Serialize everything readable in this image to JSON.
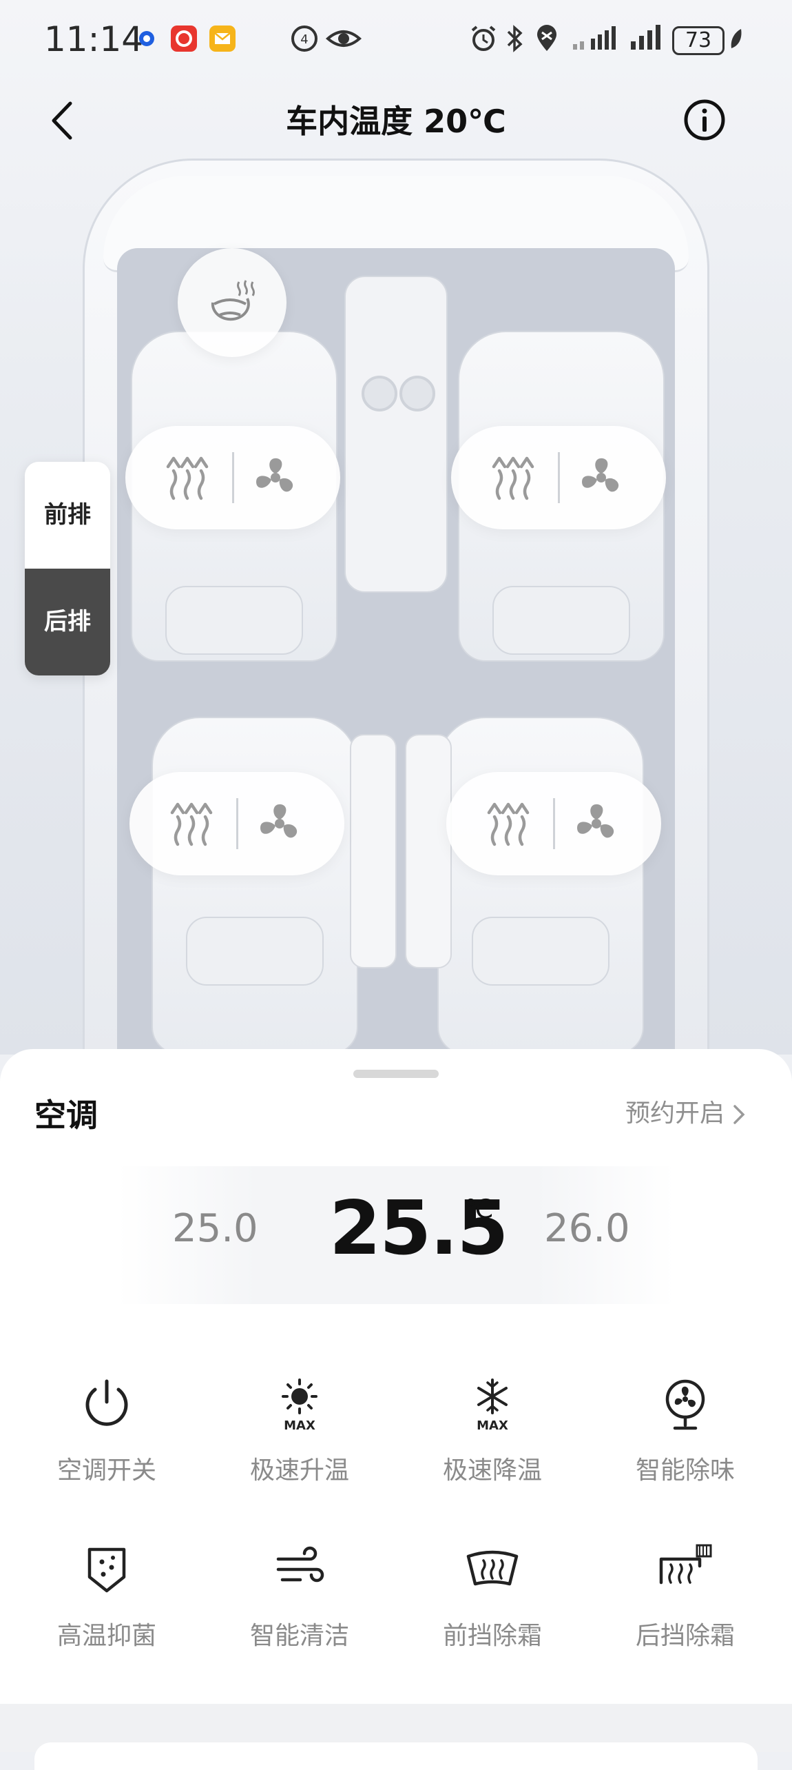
{
  "status_bar": {
    "time": "11:14",
    "battery": "73"
  },
  "header": {
    "title": "车内温度 20℃"
  },
  "row_toggle": {
    "front": "前排",
    "rear": "后排"
  },
  "climate": {
    "title": "空调",
    "schedule": "预约开启",
    "temp_prev": "25.0",
    "temp_current": "25.5",
    "temp_unit": "℃",
    "temp_next": "26.0"
  },
  "functions": [
    {
      "label": "空调开关",
      "icon": "power-icon"
    },
    {
      "label": "极速升温",
      "icon": "sun-max-icon"
    },
    {
      "label": "极速降温",
      "icon": "snowflake-max-icon"
    },
    {
      "label": "智能除味",
      "icon": "fan-deodorize-icon"
    },
    {
      "label": "高温抑菌",
      "icon": "shield-sterilize-icon"
    },
    {
      "label": "智能清洁",
      "icon": "wind-clean-icon"
    },
    {
      "label": "前挡除霜",
      "icon": "front-defrost-icon"
    },
    {
      "label": "后挡除霜",
      "icon": "rear-defrost-icon"
    }
  ]
}
